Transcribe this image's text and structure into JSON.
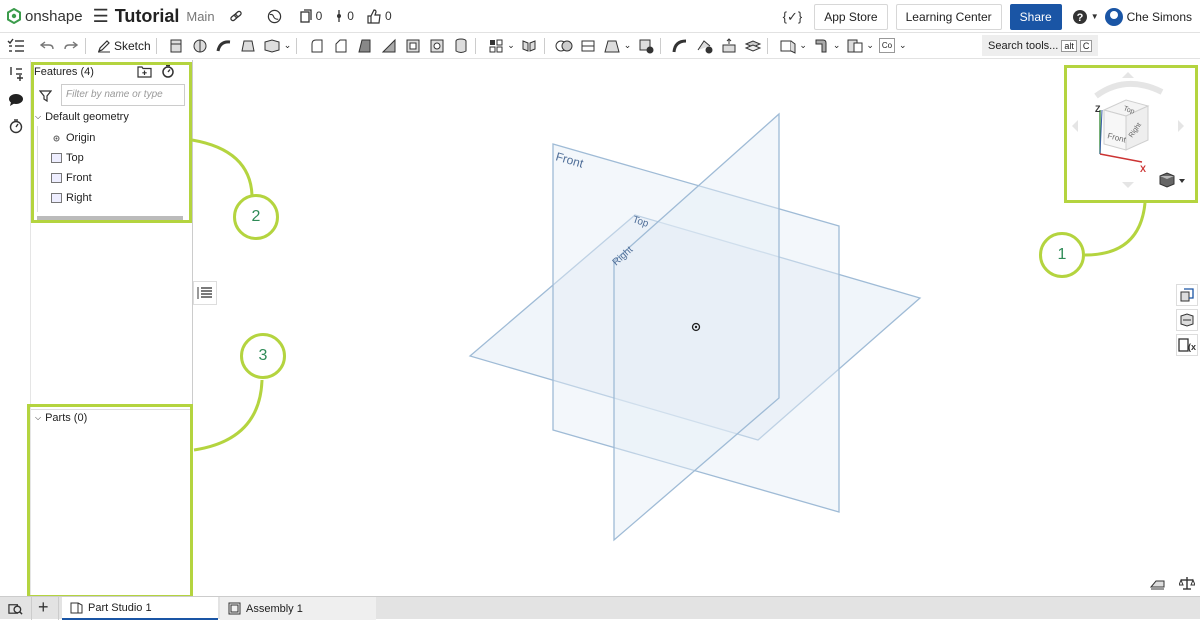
{
  "header": {
    "logo_text": "onshape",
    "doc_title": "Tutorial",
    "branch": "Main",
    "versions_count": "0",
    "branches_count": "0",
    "likes_count": "0",
    "app_store": "App Store",
    "learning_center": "Learning Center",
    "share": "Share",
    "user_name": "Che Simons"
  },
  "toolbar": {
    "sketch_label": "Sketch",
    "search_label": "Search tools...",
    "search_key1": "alt",
    "search_key2": "C",
    "custom_label": "Co"
  },
  "features": {
    "title": "Features (4)",
    "filter_placeholder": "Filter by name or type",
    "group_label": "Default geometry",
    "items": [
      "Origin",
      "Top",
      "Front",
      "Right"
    ]
  },
  "parts": {
    "title": "Parts (0)"
  },
  "viewport": {
    "plane_front": "Front",
    "plane_top": "Top",
    "plane_right": "Right"
  },
  "viewcube": {
    "top": "Top",
    "front": "Front",
    "right": "Right",
    "axis_z": "Z",
    "axis_x": "X"
  },
  "callouts": [
    "1",
    "2",
    "3"
  ],
  "tabs": [
    {
      "label": "Part Studio 1"
    },
    {
      "label": "Assembly 1"
    }
  ],
  "colors": {
    "accent": "#1a55a5",
    "highlight": "#b4d43f",
    "callout_text": "#2e8b57",
    "plane_stroke": "#9fbbd6"
  }
}
